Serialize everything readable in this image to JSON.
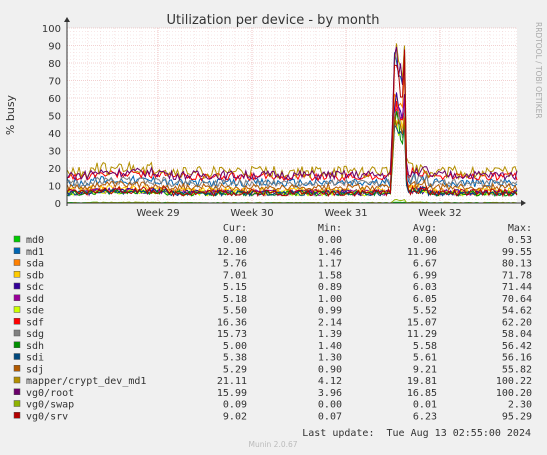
{
  "chart_data": {
    "type": "line",
    "title": "Utilization per device - by month",
    "ylabel": "% busy",
    "side_label": "RRDTOOL / TOBI OETIKER",
    "ylim": [
      0,
      100
    ],
    "yticks": [
      0,
      10,
      20,
      30,
      40,
      50,
      60,
      70,
      80,
      90,
      100
    ],
    "xticks": [
      "Week 29",
      "Week 30",
      "Week 31",
      "Week 32"
    ],
    "grid": true,
    "legend_headers": {
      "cur": "Cur:",
      "min": "Min:",
      "avg": "Avg:",
      "max": "Max:"
    },
    "series": [
      {
        "name": "md0",
        "color": "#00cc00",
        "cur": "0.00",
        "min": "0.00",
        "avg": "0.00",
        "max": "0.53",
        "base": 0.1,
        "noise": 0.2,
        "spike": 0.3
      },
      {
        "name": "md1",
        "color": "#0066b3",
        "cur": "12.16",
        "min": "1.46",
        "avg": "11.96",
        "max": "99.55",
        "base": 11.5,
        "noise": 2.5,
        "spike": 40
      },
      {
        "name": "sda",
        "color": "#ff8000",
        "cur": "5.76",
        "min": "1.17",
        "avg": "6.67",
        "max": "80.13",
        "base": 6.5,
        "noise": 1.8,
        "spike": 35
      },
      {
        "name": "sdb",
        "color": "#ffcc00",
        "cur": "7.01",
        "min": "1.58",
        "avg": "6.99",
        "max": "71.78",
        "base": 7.0,
        "noise": 1.8,
        "spike": 32
      },
      {
        "name": "sdc",
        "color": "#330099",
        "cur": "5.15",
        "min": "0.89",
        "avg": "6.03",
        "max": "71.44",
        "base": 6.0,
        "noise": 1.6,
        "spike": 30
      },
      {
        "name": "sdd",
        "color": "#990099",
        "cur": "5.18",
        "min": "1.00",
        "avg": "6.05",
        "max": "70.64",
        "base": 6.0,
        "noise": 1.6,
        "spike": 32
      },
      {
        "name": "sde",
        "color": "#ccff00",
        "cur": "5.50",
        "min": "0.99",
        "avg": "5.52",
        "max": "54.62",
        "base": 5.5,
        "noise": 1.5,
        "spike": 25
      },
      {
        "name": "sdf",
        "color": "#ff0000",
        "cur": "16.36",
        "min": "2.14",
        "avg": "15.07",
        "max": "62.20",
        "base": 15.0,
        "noise": 2.2,
        "spike": 28
      },
      {
        "name": "sdg",
        "color": "#808080",
        "cur": "15.73",
        "min": "1.39",
        "avg": "11.29",
        "max": "58.04",
        "base": 11.3,
        "noise": 2.2,
        "spike": 26
      },
      {
        "name": "sdh",
        "color": "#008f00",
        "cur": "5.00",
        "min": "1.40",
        "avg": "5.58",
        "max": "56.42",
        "base": 5.5,
        "noise": 1.5,
        "spike": 25
      },
      {
        "name": "sdi",
        "color": "#00487d",
        "cur": "5.38",
        "min": "1.30",
        "avg": "5.61",
        "max": "56.16",
        "base": 5.6,
        "noise": 1.5,
        "spike": 25
      },
      {
        "name": "sdj",
        "color": "#b35a00",
        "cur": "5.29",
        "min": "0.90",
        "avg": "9.21",
        "max": "55.82",
        "base": 9.0,
        "noise": 2.0,
        "spike": 25
      },
      {
        "name": "mapper/crypt_dev_md1",
        "color": "#b38f00",
        "cur": "21.11",
        "min": "4.12",
        "avg": "19.81",
        "max": "100.22",
        "base": 17.5,
        "noise": 3.5,
        "spike": 45
      },
      {
        "name": "vg0/root",
        "color": "#6b006b",
        "cur": "15.99",
        "min": "3.96",
        "avg": "16.85",
        "max": "100.20",
        "base": 16.0,
        "noise": 2.6,
        "spike": 60
      },
      {
        "name": "vg0/swap",
        "color": "#8fb300",
        "cur": "0.09",
        "min": "0.00",
        "avg": "0.01",
        "max": "2.30",
        "base": 0.1,
        "noise": 0.3,
        "spike": 1
      },
      {
        "name": "vg0/srv",
        "color": "#b30000",
        "cur": "9.02",
        "min": "0.07",
        "avg": "6.23",
        "max": "95.29",
        "base": 6.0,
        "noise": 2.0,
        "spike": 50
      }
    ],
    "last_update": "Last update:  Tue Aug 13 02:55:00 2024",
    "footer": "Munin 2.0.67"
  }
}
